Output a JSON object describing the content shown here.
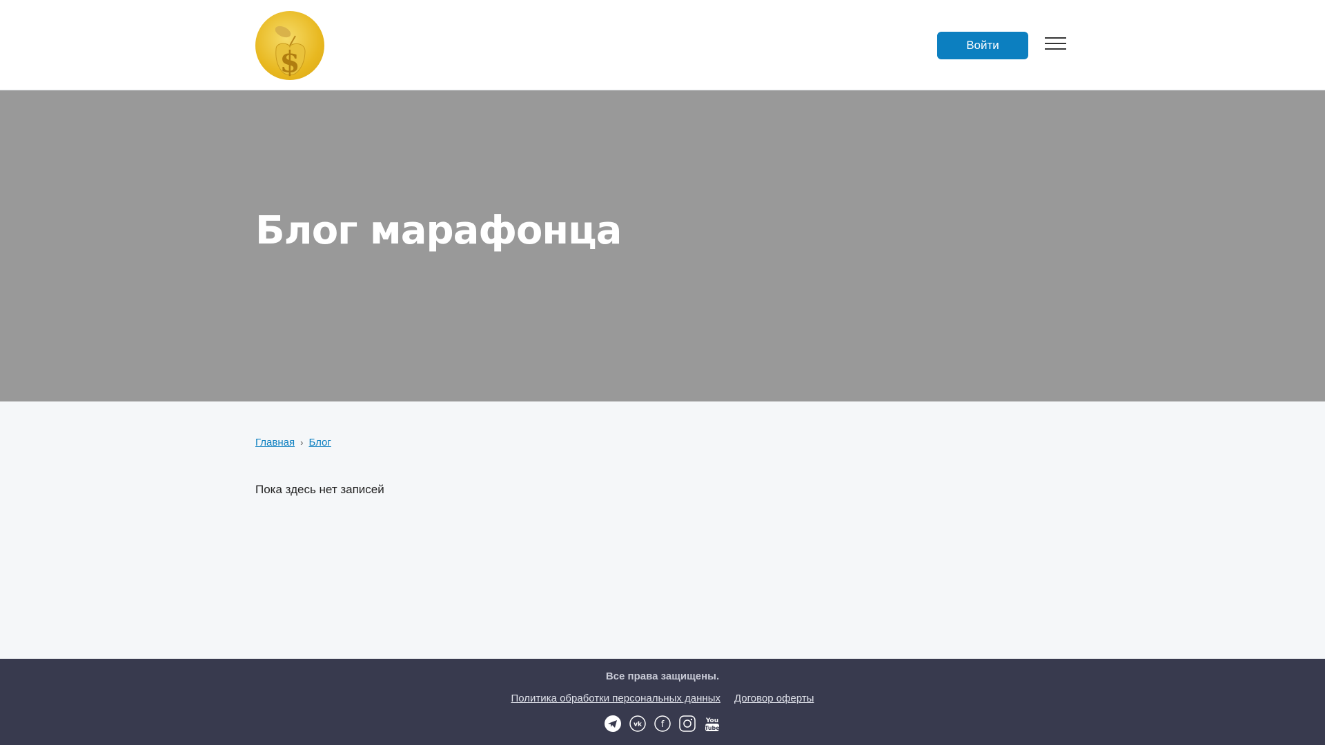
{
  "header": {
    "login_label": "Войти"
  },
  "hero": {
    "title": "Блог марафонца"
  },
  "breadcrumb": {
    "items": [
      "Главная",
      "Блог"
    ]
  },
  "main": {
    "empty_text": "Пока здесь нет записей"
  },
  "footer": {
    "copyright": "Все права защищены.",
    "links": [
      "Политика обработки персональных данных",
      "Договор оферты"
    ],
    "social": [
      "telegram-icon",
      "vk-icon",
      "facebook-icon",
      "instagram-icon",
      "youtube-icon"
    ]
  },
  "colors": {
    "accent": "#0c7fc0",
    "hero": "#999999",
    "footer": "#383a4e"
  }
}
